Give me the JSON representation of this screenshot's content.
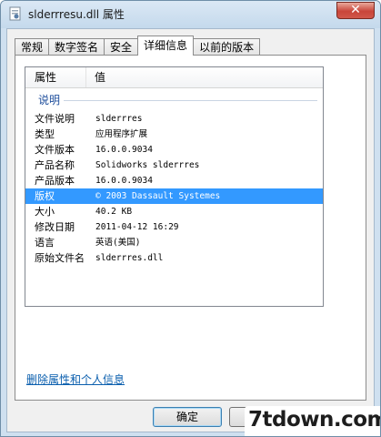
{
  "window": {
    "title": "slderrresu.dll 属性",
    "close_glyph": "✕"
  },
  "tabs": [
    {
      "label": "常规"
    },
    {
      "label": "数字签名"
    },
    {
      "label": "安全"
    },
    {
      "label": "详细信息",
      "active": true
    },
    {
      "label": "以前的版本"
    }
  ],
  "details": {
    "columns": [
      "属性",
      "值"
    ],
    "group": "说明",
    "rows": [
      {
        "name": "文件说明",
        "value": "slderrres"
      },
      {
        "name": "类型",
        "value": "应用程序扩展"
      },
      {
        "name": "文件版本",
        "value": "16.0.0.9034"
      },
      {
        "name": "产品名称",
        "value": "Solidworks slderrres"
      },
      {
        "name": "产品版本",
        "value": "16.0.0.9034"
      },
      {
        "name": "版权",
        "value": "© 2003 Dassault Systemes",
        "selected": true
      },
      {
        "name": "大小",
        "value": "40.2 KB"
      },
      {
        "name": "修改日期",
        "value": "2011-04-12 16:29"
      },
      {
        "name": "语言",
        "value": "英语(美国)"
      },
      {
        "name": "原始文件名",
        "value": "slderrres.dll"
      }
    ]
  },
  "remove_link": "删除属性和个人信息",
  "buttons": {
    "ok": "确定"
  },
  "watermark": "7tdown.com",
  "colors": {
    "selection": "#3399ff",
    "link": "#0b5fae",
    "group": "#1e4e9c"
  },
  "icons": {
    "file": "dll-file-icon",
    "close": "close-icon"
  }
}
